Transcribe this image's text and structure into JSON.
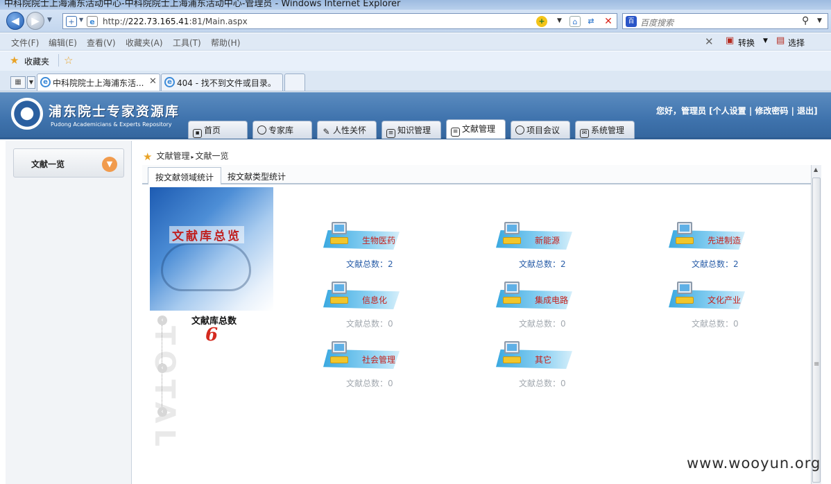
{
  "browser": {
    "window_title": "中科院院士上海浦东活动中心-中科院院士上海浦东活动中心-管理员 - Windows Internet Explorer",
    "url_prefix": "http://",
    "url_host": "222.73.165.41",
    "url_rest": ":81/Main.aspx",
    "search_placeholder": "百度搜索",
    "menu": [
      "文件(F)",
      "编辑(E)",
      "查看(V)",
      "收藏夹(A)",
      "工具(T)",
      "帮助(H)"
    ],
    "favorites_label": "收藏夹",
    "convert_label": "转换",
    "select_label": "选择",
    "tabs": [
      {
        "label": "中科院院士上海浦东活..."
      },
      {
        "label": "404 - 找不到文件或目录。"
      }
    ]
  },
  "site": {
    "title": "浦东院士专家资源库",
    "subtitle": "Pudong Academicians & Experts Repository",
    "user_links": "您好，管理员 [个人设置 | 修改密码 | 退出]",
    "nav": [
      {
        "label": "首页",
        "icon": "image-icon"
      },
      {
        "label": "专家库",
        "icon": "chat-icon"
      },
      {
        "label": "人性关怀",
        "icon": "pen-icon"
      },
      {
        "label": "知识管理",
        "icon": "document-icon"
      },
      {
        "label": "文献管理",
        "icon": "document-icon"
      },
      {
        "label": "项目会议",
        "icon": "chat-icon"
      },
      {
        "label": "系统管理",
        "icon": "mail-icon"
      }
    ],
    "active_nav": "文献管理"
  },
  "sidebar": {
    "item_label": "文献一览"
  },
  "breadcrumb": {
    "section": "文献管理",
    "separator": "▸",
    "page": "文献一览"
  },
  "subtabs": [
    "按文献领域统计",
    "按文献类型统计"
  ],
  "overview": {
    "banner_title": "文献库总览",
    "total_label": "文献库总数",
    "total_value": "6",
    "vertical_text": "TOTAL"
  },
  "categories": [
    {
      "name": "生物医药",
      "count": "文献总数：2"
    },
    {
      "name": "新能源",
      "count": "文献总数：2"
    },
    {
      "name": "先进制造",
      "count": "文献总数：2"
    },
    {
      "name": "信息化",
      "count": "文献总数：0"
    },
    {
      "name": "集成电路",
      "count": "文献总数：0"
    },
    {
      "name": "文化产业",
      "count": "文献总数：0"
    },
    {
      "name": "社会管理",
      "count": "文献总数：0"
    },
    {
      "name": "其它",
      "count": "文献总数：0"
    }
  ],
  "watermark": "www.wooyun.org",
  "colors": {
    "header_blue": "#3f73ad",
    "category_red": "#c4201b",
    "count_blue": "#2a5ea8",
    "accent_orange": "#f19b4d"
  }
}
